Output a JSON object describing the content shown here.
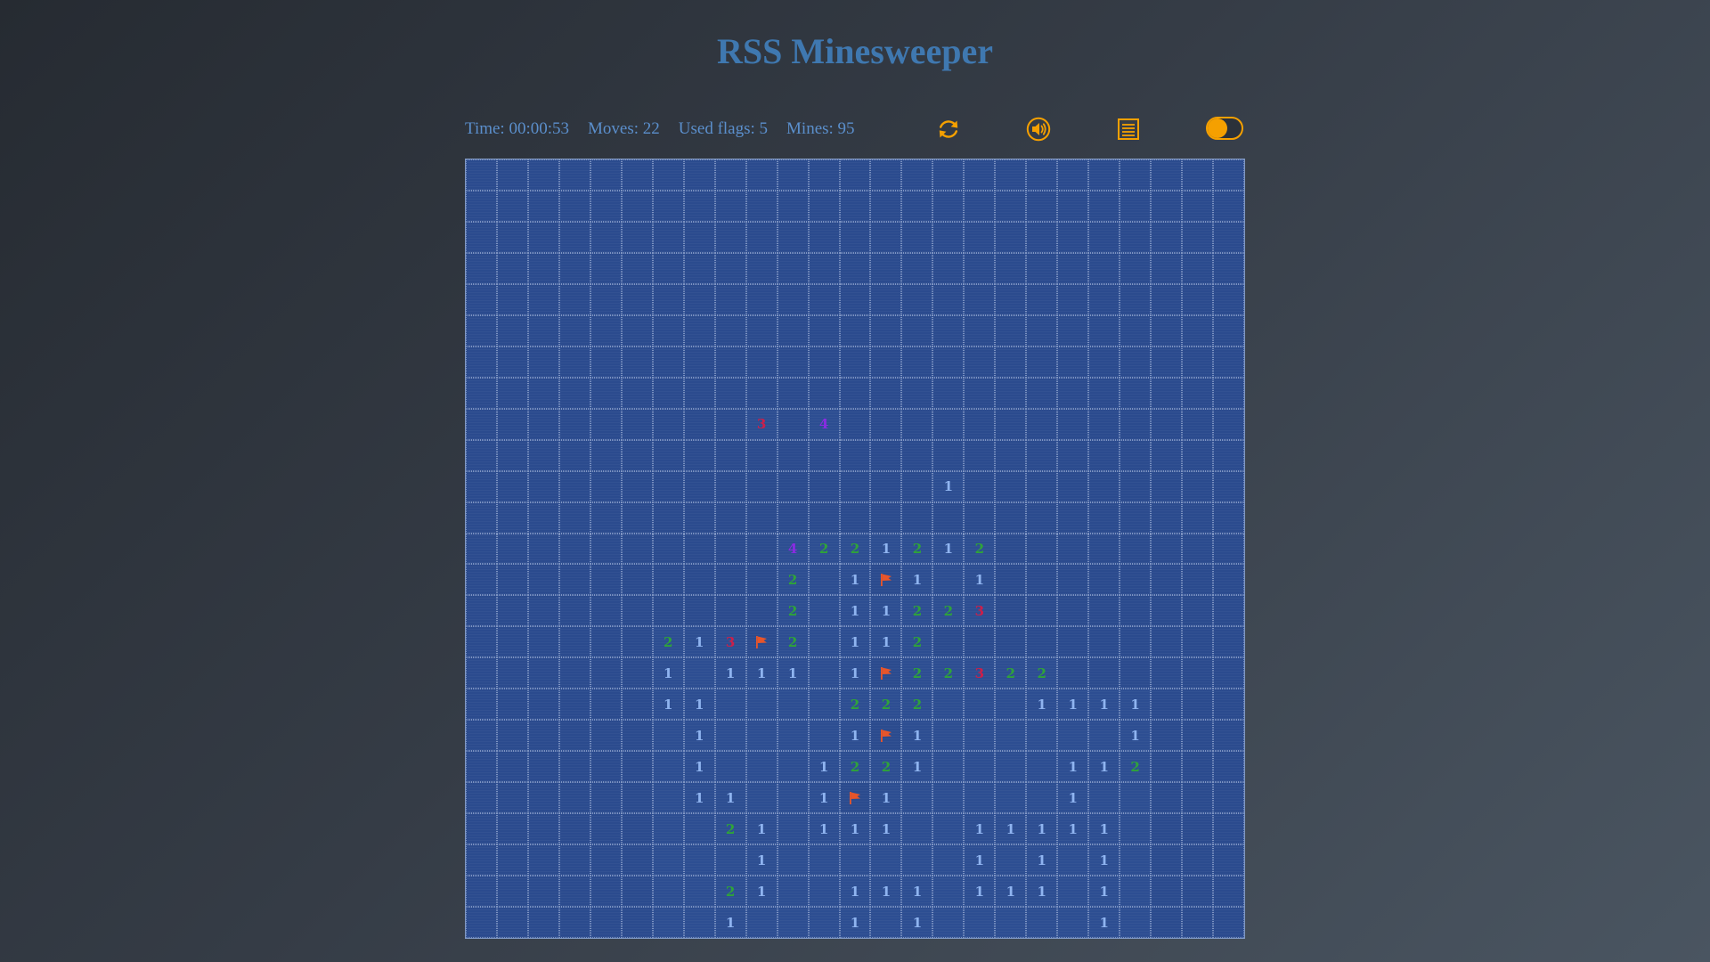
{
  "header": {
    "title": "RSS Minesweeper"
  },
  "status": {
    "time": "Time: 00:00:53",
    "moves": "Moves: 22",
    "flags": "Used flags: 5",
    "mines": "Mines: 95"
  },
  "controls": {
    "restart_icon": "restart-icon",
    "sound_icon": "sound-icon",
    "results_icon": "results-list-icon",
    "theme_toggle": "theme-toggle"
  },
  "colors": {
    "title": "#3f78b0",
    "accent": "#f5a000",
    "cell": "#2b4b8e",
    "n1": "#8fb4f0",
    "n2": "#2fa33a",
    "n3": "#cc1f4a",
    "n4": "#8a2be2",
    "flag": "#e8552a"
  },
  "board": {
    "size": 25,
    "rows": [
      [
        "#",
        "#",
        "#",
        "#",
        "#",
        "#",
        "#",
        "#",
        "#",
        "#",
        "#",
        "#",
        "#",
        "#",
        "#",
        "#",
        "#",
        "#",
        "#",
        "#",
        "#",
        "#",
        "#",
        "#",
        "#"
      ],
      [
        "#",
        "#",
        "#",
        "#",
        "#",
        "#",
        "#",
        "#",
        "#",
        "#",
        "#",
        "#",
        "#",
        "#",
        "#",
        "#",
        "#",
        "#",
        "#",
        "#",
        "#",
        "#",
        "#",
        "#",
        "#"
      ],
      [
        "#",
        "#",
        "#",
        "#",
        "#",
        "#",
        "#",
        "#",
        "#",
        "#",
        "#",
        "#",
        "#",
        "#",
        "#",
        "#",
        "#",
        "#",
        "#",
        "#",
        "#",
        "#",
        "#",
        "#",
        "#"
      ],
      [
        "#",
        "#",
        "#",
        "#",
        "#",
        "#",
        "#",
        "#",
        "#",
        "#",
        "#",
        "#",
        "#",
        "#",
        "#",
        "#",
        "#",
        "#",
        "#",
        "#",
        "#",
        "#",
        "#",
        "#",
        "#"
      ],
      [
        "#",
        "#",
        "#",
        "#",
        "#",
        "#",
        "#",
        "#",
        "#",
        "#",
        "#",
        "#",
        "#",
        "#",
        "#",
        "#",
        "#",
        "#",
        "#",
        "#",
        "#",
        "#",
        "#",
        "#",
        "#"
      ],
      [
        "#",
        "#",
        "#",
        "#",
        "#",
        "#",
        "#",
        "#",
        "#",
        "#",
        "#",
        "#",
        "#",
        "#",
        "#",
        "#",
        "#",
        "#",
        "#",
        "#",
        "#",
        "#",
        "#",
        "#",
        "#"
      ],
      [
        "#",
        "#",
        "#",
        "#",
        "#",
        "#",
        "#",
        "#",
        "#",
        "#",
        "#",
        "#",
        "#",
        "#",
        "#",
        "#",
        "#",
        "#",
        "#",
        "#",
        "#",
        "#",
        "#",
        "#",
        "#"
      ],
      [
        "#",
        "#",
        "#",
        "#",
        "#",
        "#",
        "#",
        "#",
        "#",
        "#",
        "#",
        "#",
        "#",
        "#",
        "#",
        "#",
        "#",
        "#",
        "#",
        "#",
        "#",
        "#",
        "#",
        "#",
        "#"
      ],
      [
        "#",
        "#",
        "#",
        "#",
        "#",
        "#",
        "#",
        "#",
        "#",
        "3",
        "#",
        "4",
        "#",
        "#",
        "#",
        "#",
        "#",
        "#",
        "#",
        "#",
        "#",
        "#",
        "#",
        "#",
        "#"
      ],
      [
        "#",
        "#",
        "#",
        "#",
        "#",
        "#",
        "#",
        "#",
        "#",
        "#",
        "#",
        "#",
        "#",
        "#",
        "#",
        "#",
        "#",
        "#",
        "#",
        "#",
        "#",
        "#",
        "#",
        "#",
        "#"
      ],
      [
        "#",
        "#",
        "#",
        "#",
        "#",
        "#",
        "#",
        "#",
        "#",
        "#",
        "#",
        "#",
        "#",
        "#",
        "#",
        "1",
        "#",
        "#",
        "#",
        "#",
        "#",
        "#",
        "#",
        "#",
        "#"
      ],
      [
        "#",
        "#",
        "#",
        "#",
        "#",
        "#",
        "#",
        "#",
        "#",
        "#",
        "#",
        "#",
        "#",
        "#",
        "#",
        "#",
        "#",
        "#",
        "#",
        "#",
        "#",
        "#",
        "#",
        "#",
        "#"
      ],
      [
        "#",
        "#",
        "#",
        "#",
        "#",
        "#",
        "#",
        "#",
        "#",
        "#",
        "4",
        "2",
        "2",
        "1",
        "2",
        "1",
        "2",
        "#",
        "#",
        "#",
        "#",
        "#",
        "#",
        "#",
        "#"
      ],
      [
        "#",
        "#",
        "#",
        "#",
        "#",
        "#",
        "#",
        "#",
        "#",
        "#",
        "2",
        "",
        "1",
        "F",
        "1",
        "",
        "1",
        "#",
        "#",
        "#",
        "#",
        "#",
        "#",
        "#",
        "#"
      ],
      [
        "#",
        "#",
        "#",
        "#",
        "#",
        "#",
        "#",
        "#",
        "#",
        "#",
        "2",
        "",
        "1",
        "1",
        "2",
        "2",
        "3",
        "#",
        "#",
        "#",
        "#",
        "#",
        "#",
        "#",
        "#"
      ],
      [
        "#",
        "#",
        "#",
        "#",
        "#",
        "#",
        "2",
        "1",
        "3",
        "F",
        "2",
        "",
        "1",
        "1",
        "2",
        "#",
        "#",
        "#",
        "#",
        "#",
        "#",
        "#",
        "#",
        "#",
        "#"
      ],
      [
        "#",
        "#",
        "#",
        "#",
        "#",
        "#",
        "1",
        "",
        "1",
        "1",
        "1",
        "",
        "1",
        "F",
        "2",
        "2",
        "3",
        "2",
        "2",
        "#",
        "#",
        "#",
        "#",
        "#",
        "#"
      ],
      [
        "#",
        "#",
        "#",
        "#",
        "#",
        "#",
        "1",
        "1",
        "",
        "",
        "",
        "",
        "2",
        "2",
        "2",
        "",
        "",
        "",
        "1",
        "1",
        "1",
        "1",
        "#",
        "#",
        "#"
      ],
      [
        "#",
        "#",
        "#",
        "#",
        "#",
        "#",
        "",
        "1",
        "",
        "",
        "",
        "",
        "1",
        "F",
        "1",
        "",
        "",
        "",
        "",
        "",
        "",
        "1",
        "#",
        "#",
        "#"
      ],
      [
        "#",
        "#",
        "#",
        "#",
        "#",
        "#",
        "",
        "1",
        "",
        "",
        "",
        "1",
        "2",
        "2",
        "1",
        "",
        "",
        "",
        "",
        "1",
        "1",
        "2",
        "#",
        "#",
        "#"
      ],
      [
        "#",
        "#",
        "#",
        "#",
        "#",
        "#",
        "",
        "1",
        "1",
        "",
        "",
        "1",
        "F",
        "1",
        "",
        "",
        "",
        "",
        "",
        "1",
        "",
        "",
        "#",
        "#",
        "#"
      ],
      [
        "#",
        "#",
        "#",
        "#",
        "#",
        "#",
        "",
        "",
        "2",
        "1",
        "",
        "1",
        "1",
        "1",
        "",
        "",
        "1",
        "1",
        "1",
        "1",
        "1",
        "",
        "#",
        "#",
        "#"
      ],
      [
        "#",
        "#",
        "#",
        "#",
        "#",
        "#",
        "",
        "",
        "",
        "1",
        "",
        "",
        "",
        "",
        "",
        "",
        "1",
        "",
        "1",
        "",
        "1",
        "",
        "#",
        "#",
        "#"
      ],
      [
        "#",
        "#",
        "#",
        "#",
        "#",
        "#",
        "",
        "",
        "2",
        "1",
        "",
        "",
        "1",
        "1",
        "1",
        "",
        "1",
        "1",
        "1",
        "",
        "1",
        "",
        "#",
        "#",
        "#"
      ],
      [
        "#",
        "#",
        "#",
        "#",
        "#",
        "#",
        "",
        "",
        "1",
        "",
        "",
        "",
        "1",
        "",
        "1",
        "",
        "",
        "",
        "",
        "",
        "1",
        "",
        "#",
        "#",
        "#"
      ]
    ]
  }
}
